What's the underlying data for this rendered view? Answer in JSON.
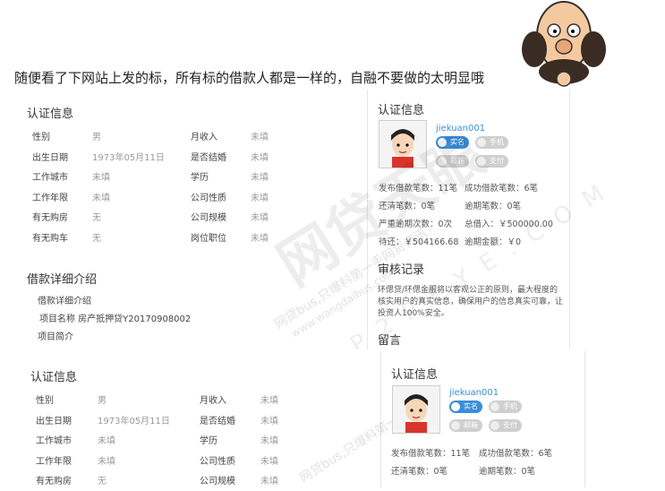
{
  "caption": "随便看了下网站上发的标，所有标的借款人都是一样的，自融不要做的太明显哦",
  "panel_top": {
    "auth_title": "认证信息",
    "fields": [
      {
        "label": "性别",
        "value": "男",
        "label2": "月收入",
        "value2": "未填"
      },
      {
        "label": "出生日期",
        "value": "1973年05月11日",
        "label2": "是否结婚",
        "value2": "未填"
      },
      {
        "label": "工作城市",
        "value": "未填",
        "label2": "学历",
        "value2": "未填"
      },
      {
        "label": "工作年限",
        "value": "未填",
        "label2": "公司性质",
        "value2": "未填"
      },
      {
        "label": "有无购房",
        "value": "无",
        "label2": "公司规模",
        "value2": "未填"
      },
      {
        "label": "有无购车",
        "value": "无",
        "label2": "岗位职位",
        "value2": "未填"
      }
    ],
    "loan_title": "借款详细介绍",
    "loan_sub": "借款详细介绍",
    "project_name": "项目名称 房产抵押贷Y20170908002",
    "project_intro": "项目简介"
  },
  "side_top": {
    "title": "认证信息",
    "username": "jiekuan001",
    "badges": [
      "实名",
      "手机",
      "邮箱",
      "支付"
    ],
    "stats": [
      [
        "发布借款笔数：11笔",
        "成功借款笔数：6笔"
      ],
      [
        "还清笔数：0笔",
        "逾期笔数：0笔"
      ],
      [
        "严重逾期次数：0次",
        "总借入：￥500000.00"
      ],
      [
        "待还：￥504166.68",
        "逾期金额：￥0"
      ]
    ],
    "review_title": "审核记录",
    "review_text": "环偲贷/环偲金服将以客观公正的原则，最大程度的核实用户的真实信息，确保用户的信息真实可靠，让投资人100%安全。",
    "message_title": "留言"
  },
  "panel_bottom": {
    "auth_title": "认证信息",
    "fields": [
      {
        "label": "性别",
        "value": "男",
        "label2": "月收入",
        "value2": "未填"
      },
      {
        "label": "出生日期",
        "value": "1973年05月11日",
        "label2": "是否结婚",
        "value2": "未填"
      },
      {
        "label": "工作城市",
        "value": "未填",
        "label2": "学历",
        "value2": "未填"
      },
      {
        "label": "工作年限",
        "value": "未填",
        "label2": "公司性质",
        "value2": "未填"
      },
      {
        "label": "有无购房",
        "value": "无",
        "label2": "公司规模",
        "value2": "未填"
      }
    ]
  },
  "side_bottom": {
    "title": "认证信息",
    "username": "jiekuan001",
    "badges": [
      "实名",
      "手机",
      "邮箱",
      "支付"
    ],
    "stats": [
      [
        "发布借款笔数：11笔",
        "成功借款笔数：6笔"
      ],
      [
        "还清笔数：0笔",
        "逾期笔数：0笔"
      ]
    ]
  },
  "watermark": {
    "line1": "网贷bus,只爆料第一手网贷资讯",
    "line2": "www.wangdaibus.com",
    "big": "网贷天眼",
    "letters": "P2PEYE.COM"
  },
  "colors": {
    "accent": "#3a8ed8",
    "muted": "#999999",
    "divider": "#e6e6e6"
  }
}
